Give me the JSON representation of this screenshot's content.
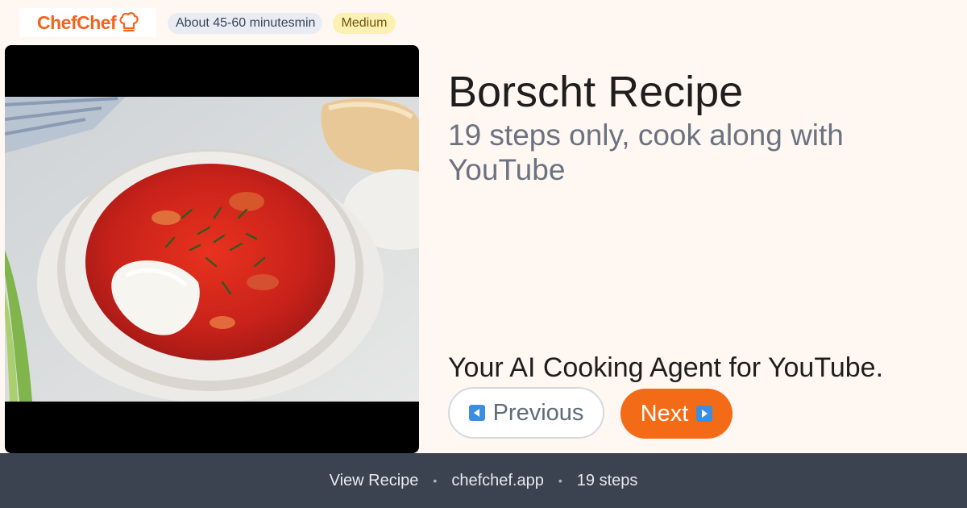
{
  "header": {
    "brand": "ChefChef",
    "logo_icon": "chef-hat-icon",
    "time_badge": "About 45-60 minutesmin",
    "difficulty_badge": "Medium"
  },
  "media": {
    "image_alt": "Bowl of borscht with sour cream and dill"
  },
  "recipe": {
    "title": "Borscht Recipe",
    "subtitle": "19 steps only, cook along with YouTube",
    "tagline": "Your AI Cooking Agent for YouTube."
  },
  "nav": {
    "previous_label": "Previous",
    "previous_icon": "arrow-left-icon",
    "next_label": "Next",
    "next_icon": "arrow-right-icon"
  },
  "footer": {
    "view_recipe": "View Recipe",
    "site": "chefchef.app",
    "steps": "19 steps",
    "separator": "•"
  },
  "colors": {
    "brand_orange": "#f36b16",
    "background": "#fff7f2",
    "footer_bg": "#3b4350",
    "difficulty_bg": "#fdf0b3",
    "time_bg": "#e9edf3",
    "arrow_icon_blue": "#3b8ee0"
  }
}
